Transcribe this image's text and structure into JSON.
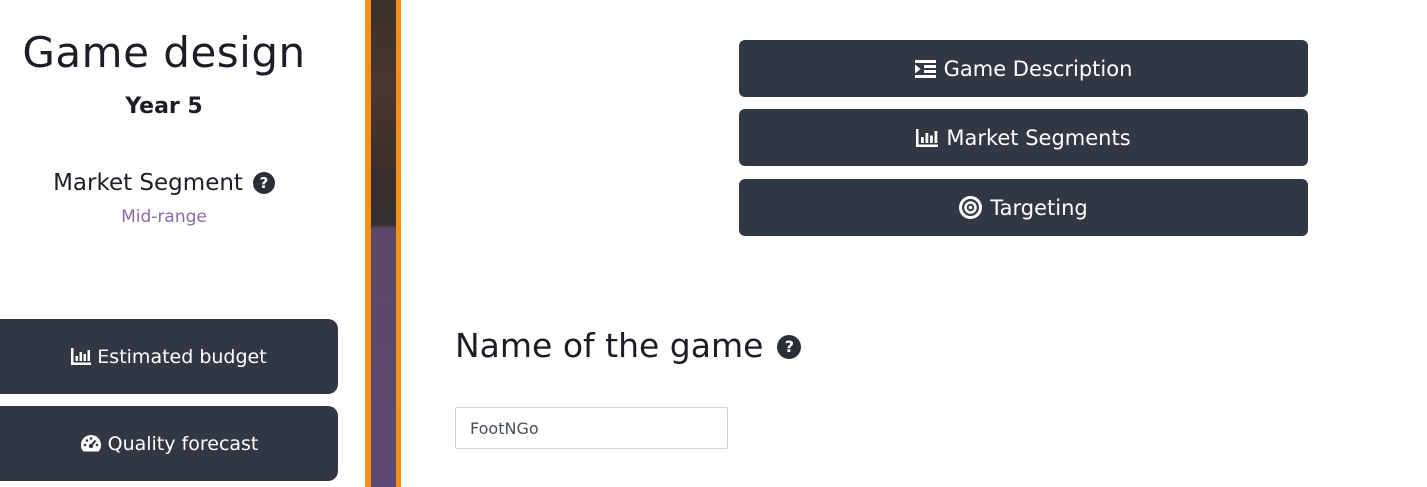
{
  "left_panel": {
    "title": "Game design",
    "year": "Year 5",
    "segment_label": "Market Segment",
    "segment_value": "Mid-range",
    "buttons": [
      {
        "label": "Estimated budget",
        "icon": "chart-bar-icon"
      },
      {
        "label": "Quality forecast",
        "icon": "tachometer-icon"
      }
    ]
  },
  "nav": {
    "buttons": [
      {
        "label": "Game Description",
        "icon": "indent-icon"
      },
      {
        "label": "Market Segments",
        "icon": "chart-bar-icon"
      },
      {
        "label": "Targeting",
        "icon": "target-icon"
      }
    ]
  },
  "form": {
    "name_heading": "Name of the game",
    "name_value": "FootNGo"
  },
  "colors": {
    "button_bg": "#323744",
    "accent_strip": "#f39019",
    "segment_value": "#8a6aa4"
  }
}
